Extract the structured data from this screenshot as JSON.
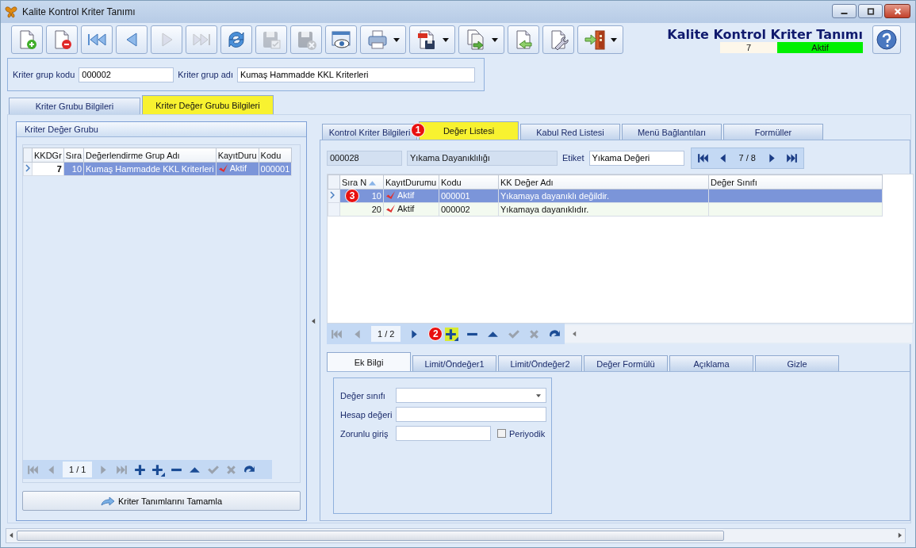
{
  "window": {
    "title": "Kalite Kontrol Kriter Tanımı"
  },
  "toolbar": {
    "buttons": [
      {
        "kind": "new",
        "disabled": false,
        "dropdown": false
      },
      {
        "kind": "delete",
        "disabled": false,
        "dropdown": false
      },
      {
        "kind": "first",
        "disabled": false,
        "dropdown": false
      },
      {
        "kind": "prev",
        "disabled": false,
        "dropdown": false
      },
      {
        "kind": "next",
        "disabled": true,
        "dropdown": false
      },
      {
        "kind": "last",
        "disabled": true,
        "dropdown": false
      },
      {
        "kind": "refresh",
        "disabled": false,
        "dropdown": false
      },
      {
        "kind": "save",
        "disabled": true,
        "dropdown": false
      },
      {
        "kind": "discard",
        "disabled": true,
        "dropdown": false
      },
      {
        "kind": "preview",
        "disabled": false,
        "dropdown": false
      },
      {
        "kind": "print",
        "disabled": false,
        "dropdown": true
      },
      {
        "kind": "pdf",
        "disabled": false,
        "dropdown": true
      },
      {
        "kind": "export",
        "disabled": false,
        "dropdown": true
      },
      {
        "kind": "import",
        "disabled": false,
        "dropdown": false
      },
      {
        "kind": "settings",
        "disabled": false,
        "dropdown": false
      },
      {
        "kind": "exit",
        "disabled": false,
        "dropdown": true
      }
    ]
  },
  "header": {
    "title": "Kalite Kontrol Kriter Tanımı",
    "record_no": "7",
    "status": "Aktif",
    "status_active": true
  },
  "group": {
    "fields": [
      {
        "label": "Kriter grup kodu",
        "value": "000002"
      },
      {
        "label": "Kriter grup adı",
        "value": "Kumaş Hammadde KKL Kriterleri"
      }
    ]
  },
  "main_tabs": [
    {
      "label": "Kriter Grubu Bilgileri",
      "selected": false
    },
    {
      "label": "Kriter Değer Grubu Bilgileri",
      "selected": true
    }
  ],
  "left_panel": {
    "title": "Kriter Değer Grubu",
    "columns": [
      "KKDGr",
      "Sıra",
      "Değerlendirme Grup Adı",
      "KayıtDuru",
      "Kodu"
    ],
    "rows": [
      {
        "cells": [
          "7",
          "10",
          "Kumaş Hammadde KKL Kriterleri",
          "Aktif",
          "000001"
        ],
        "checked": true,
        "selected": true
      }
    ],
    "navigator": {
      "page": "1 / 1",
      "buttons": [
        {
          "kind": "first",
          "disabled": true
        },
        {
          "kind": "prev",
          "disabled": true
        },
        {
          "kind": "page"
        },
        {
          "kind": "next",
          "disabled": true
        },
        {
          "kind": "last",
          "disabled": true
        },
        {
          "kind": "add",
          "disabled": false
        },
        {
          "kind": "insert",
          "disabled": false
        },
        {
          "kind": "remove",
          "disabled": false
        },
        {
          "kind": "up",
          "disabled": false
        },
        {
          "kind": "confirm",
          "disabled": true
        },
        {
          "kind": "cancel",
          "disabled": true
        },
        {
          "kind": "refresh",
          "disabled": false
        }
      ]
    },
    "button": "Kriter Tanımlarını Tamamla"
  },
  "right_panel": {
    "tabs": [
      {
        "label": "Kontrol Kriter Bilgileri",
        "selected": false
      },
      {
        "label": "Değer Listesi",
        "selected": true,
        "badge": "1"
      },
      {
        "label": "Kabul Red Listesi",
        "selected": false
      },
      {
        "label": "Menü Bağlantıları",
        "selected": false
      },
      {
        "label": "Formüller",
        "selected": false
      }
    ],
    "record": {
      "code": "000028",
      "name": "Yıkama Dayanıklılığı",
      "label": "Etiket",
      "value": "Yıkama Değeri",
      "position": "7 / 8"
    },
    "columns": [
      {
        "label": "Sıra N",
        "sorted": true
      },
      {
        "label": "KayıtDurumu",
        "sorted": false
      },
      {
        "label": "Kodu",
        "sorted": false
      },
      {
        "label": "KK Değer Adı",
        "sorted": false
      },
      {
        "label": "Değer Sınıfı",
        "sorted": false
      }
    ],
    "rows": [
      {
        "cells": [
          "10",
          "Aktif",
          "000001",
          "Yıkamaya dayanıklı değildir."
        ],
        "checked": true,
        "selected": true,
        "badge": "3"
      },
      {
        "cells": [
          "20",
          "Aktif",
          "000002",
          "Yıkamaya dayanıklıdır."
        ],
        "checked": true,
        "selected": false
      }
    ],
    "navigator": {
      "page": "1 / 2",
      "buttons": [
        {
          "kind": "first",
          "disabled": true
        },
        {
          "kind": "prev",
          "disabled": true
        },
        {
          "kind": "page"
        },
        {
          "kind": "next",
          "disabled": false
        },
        {
          "kind": "insert",
          "disabled": false,
          "highlighted": true,
          "badge": "2"
        },
        {
          "kind": "remove",
          "disabled": false
        },
        {
          "kind": "up",
          "disabled": false
        },
        {
          "kind": "confirm",
          "disabled": true
        },
        {
          "kind": "cancel",
          "disabled": true
        },
        {
          "kind": "refresh",
          "disabled": false
        }
      ]
    },
    "sub_tabs": [
      {
        "label": "Ek Bilgi",
        "selected": true
      },
      {
        "label": "Limit/Öndeğer1",
        "selected": false
      },
      {
        "label": "Limit/Öndeğer2",
        "selected": false
      },
      {
        "label": "Değer Formülü",
        "selected": false
      },
      {
        "label": "Açıklama",
        "selected": false
      },
      {
        "label": "Gizle",
        "selected": false
      }
    ],
    "form": {
      "fields": [
        {
          "label": "Değer sınıfı",
          "kind": "dropdown"
        },
        {
          "label": "Hesap değeri",
          "kind": "text"
        },
        {
          "label": "Zorunlu giriş",
          "kind": "text_check",
          "check_label": "Periyodik",
          "checked": false
        }
      ]
    }
  }
}
